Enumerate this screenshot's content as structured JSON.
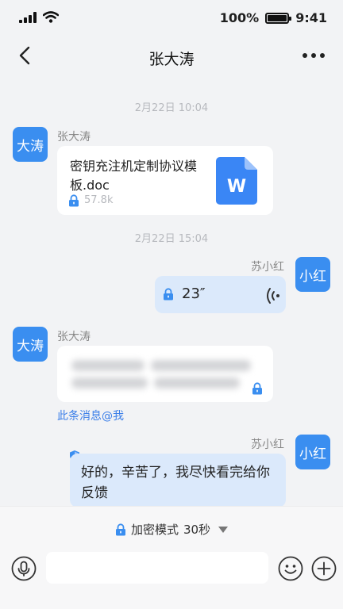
{
  "status": {
    "battery": "100%",
    "time": "9:41"
  },
  "nav": {
    "title": "张大涛"
  },
  "messages": {
    "t1": "2月22日 10:04",
    "m1": {
      "avatar": "大涛",
      "sender": "张大涛",
      "file_name": "密钥充注机定制协议模板.doc",
      "file_size": "57.8k",
      "file_icon_letter": "W"
    },
    "t2": "2月22日 15:04",
    "m2": {
      "avatar": "小红",
      "sender": "苏小红",
      "duration": "23″"
    },
    "m3": {
      "avatar": "大涛",
      "sender": "张大涛",
      "mention": "此条消息@我"
    },
    "m4": {
      "avatar": "小红",
      "sender": "苏小红",
      "text": "好的，辛苦了，我尽快看完给你反馈"
    }
  },
  "composer": {
    "mode_label": "加密模式",
    "mode_value": "30秒",
    "placeholder": ""
  },
  "colors": {
    "accent": "#3a8ef0",
    "bubble_blue": "#dbe9fb",
    "word_blue": "#3a86f5"
  }
}
